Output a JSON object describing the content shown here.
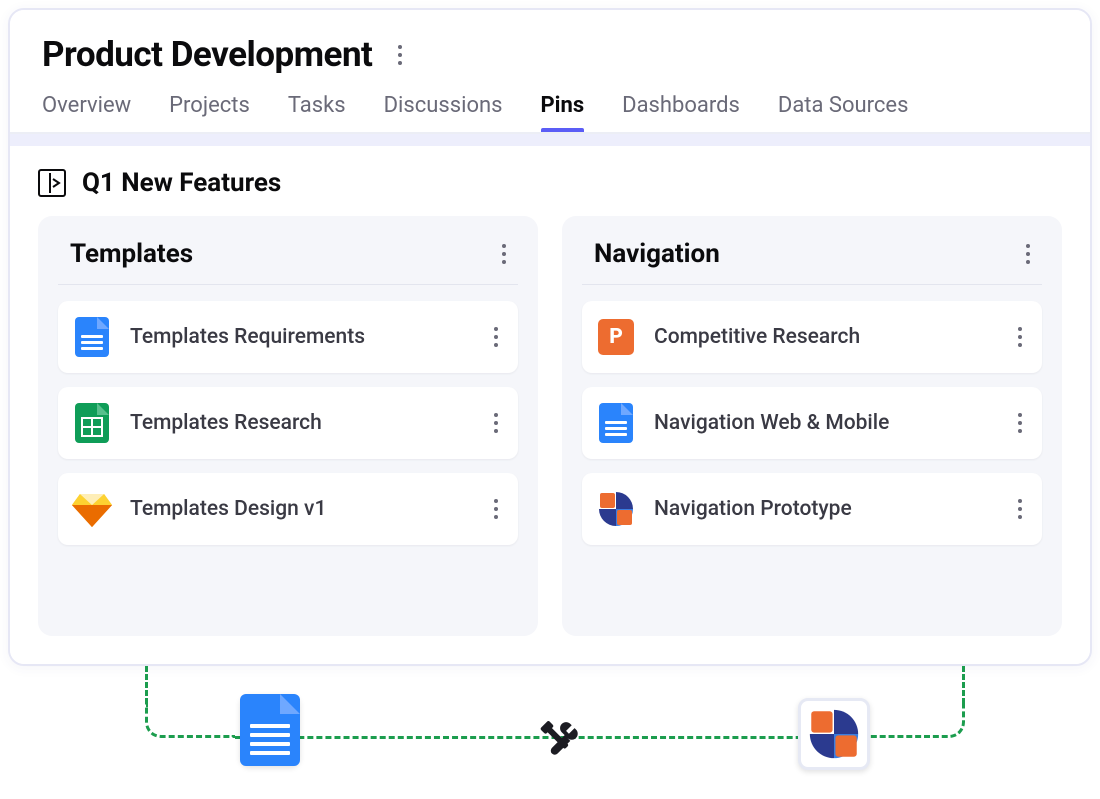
{
  "header": {
    "title": "Product Development"
  },
  "tabs": [
    {
      "label": "Overview",
      "active": false
    },
    {
      "label": "Projects",
      "active": false
    },
    {
      "label": "Tasks",
      "active": false
    },
    {
      "label": "Discussions",
      "active": false
    },
    {
      "label": "Pins",
      "active": true
    },
    {
      "label": "Dashboards",
      "active": false
    },
    {
      "label": "Data Sources",
      "active": false
    }
  ],
  "section": {
    "title": "Q1 New Features"
  },
  "columns": [
    {
      "title": "Templates",
      "cards": [
        {
          "label": "Templates Requirements",
          "icon": "doc"
        },
        {
          "label": "Templates Research",
          "icon": "sheet"
        },
        {
          "label": "Templates Design v1",
          "icon": "sketch"
        }
      ]
    },
    {
      "title": "Navigation",
      "cards": [
        {
          "label": "Competitive Research",
          "icon": "ppt"
        },
        {
          "label": "Navigation Web & Mobile",
          "icon": "doc"
        },
        {
          "label": "Navigation Prototype",
          "icon": "proto"
        }
      ]
    }
  ],
  "diagram": {
    "left_icon": "doc",
    "center_icon": "tools",
    "right_icon": "proto"
  }
}
